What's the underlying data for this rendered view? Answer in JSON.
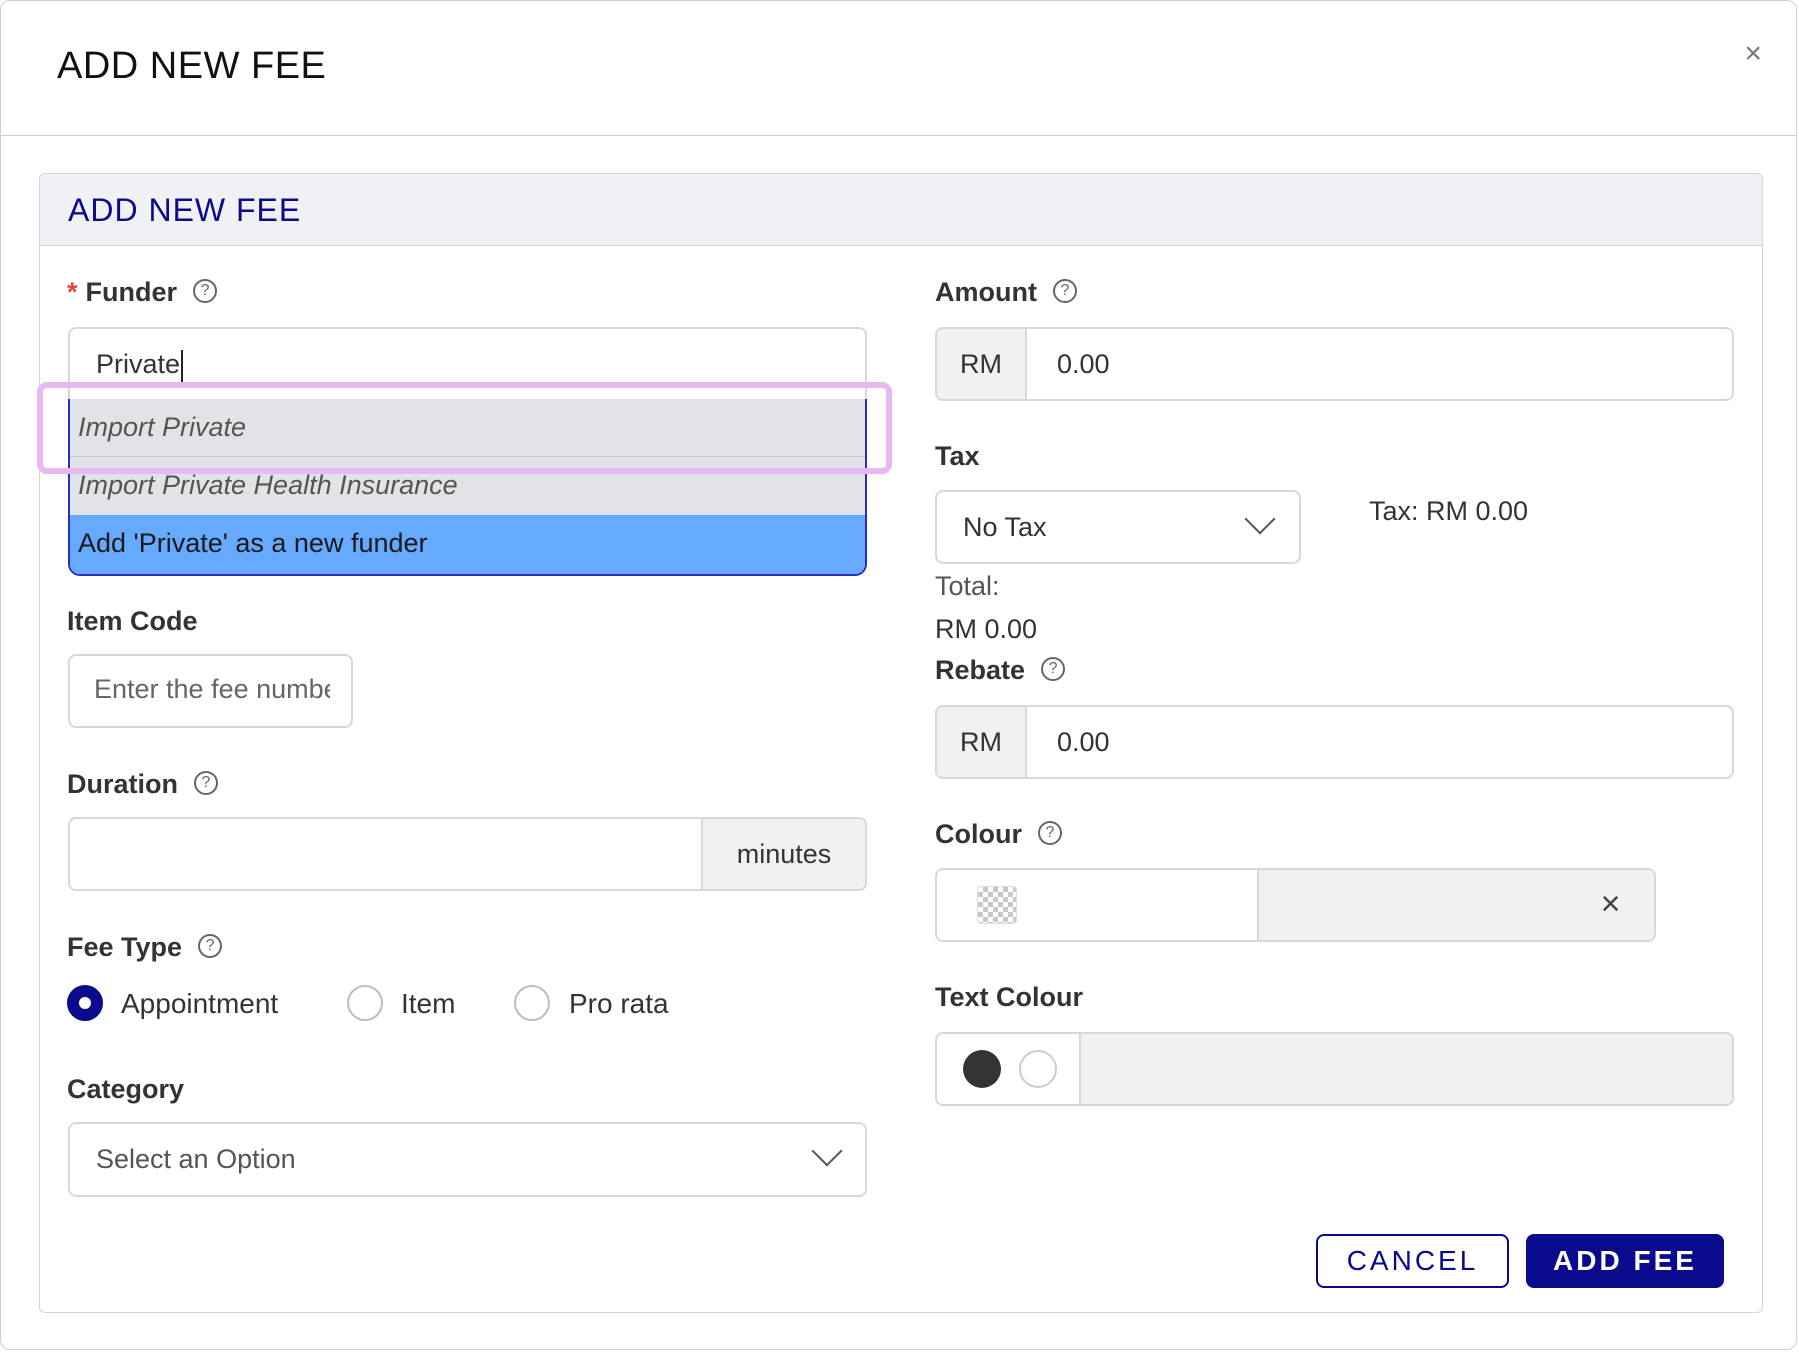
{
  "modal": {
    "title": "ADD NEW FEE",
    "close_symbol": "×"
  },
  "panel": {
    "title": "ADD NEW FEE"
  },
  "funder": {
    "required_mark": "*",
    "label": "Funder",
    "value": "Private",
    "suggestions": [
      "Import Private",
      "Import Private Health Insurance",
      "Add 'Private' as a new funder"
    ]
  },
  "item_code": {
    "label": "Item Code",
    "placeholder": "Enter the fee number"
  },
  "duration": {
    "label": "Duration",
    "value": "",
    "unit": "minutes"
  },
  "fee_type": {
    "label": "Fee Type",
    "options": [
      "Appointment",
      "Item",
      "Pro rata"
    ],
    "selected": "Appointment"
  },
  "category": {
    "label": "Category",
    "placeholder": "Select an Option"
  },
  "amount": {
    "label": "Amount",
    "currency": "RM",
    "value": "0.00"
  },
  "tax": {
    "label": "Tax",
    "selected": "No Tax",
    "summary": "Tax: RM 0.00",
    "total_label": "Total:",
    "total_value": "RM 0.00"
  },
  "rebate": {
    "label": "Rebate",
    "currency": "RM",
    "value": "0.00"
  },
  "colour": {
    "label": "Colour",
    "clear_symbol": "×"
  },
  "text_colour": {
    "label": "Text Colour",
    "options": [
      "#333333",
      "#ffffff"
    ]
  },
  "help_symbol": "?",
  "actions": {
    "cancel": "CANCEL",
    "add": "ADD FEE"
  },
  "colors": {
    "accent": "#0a0a8c",
    "highlight_option": "#66aaff",
    "callout": "#e8b8f5",
    "required": "#e0443c"
  }
}
